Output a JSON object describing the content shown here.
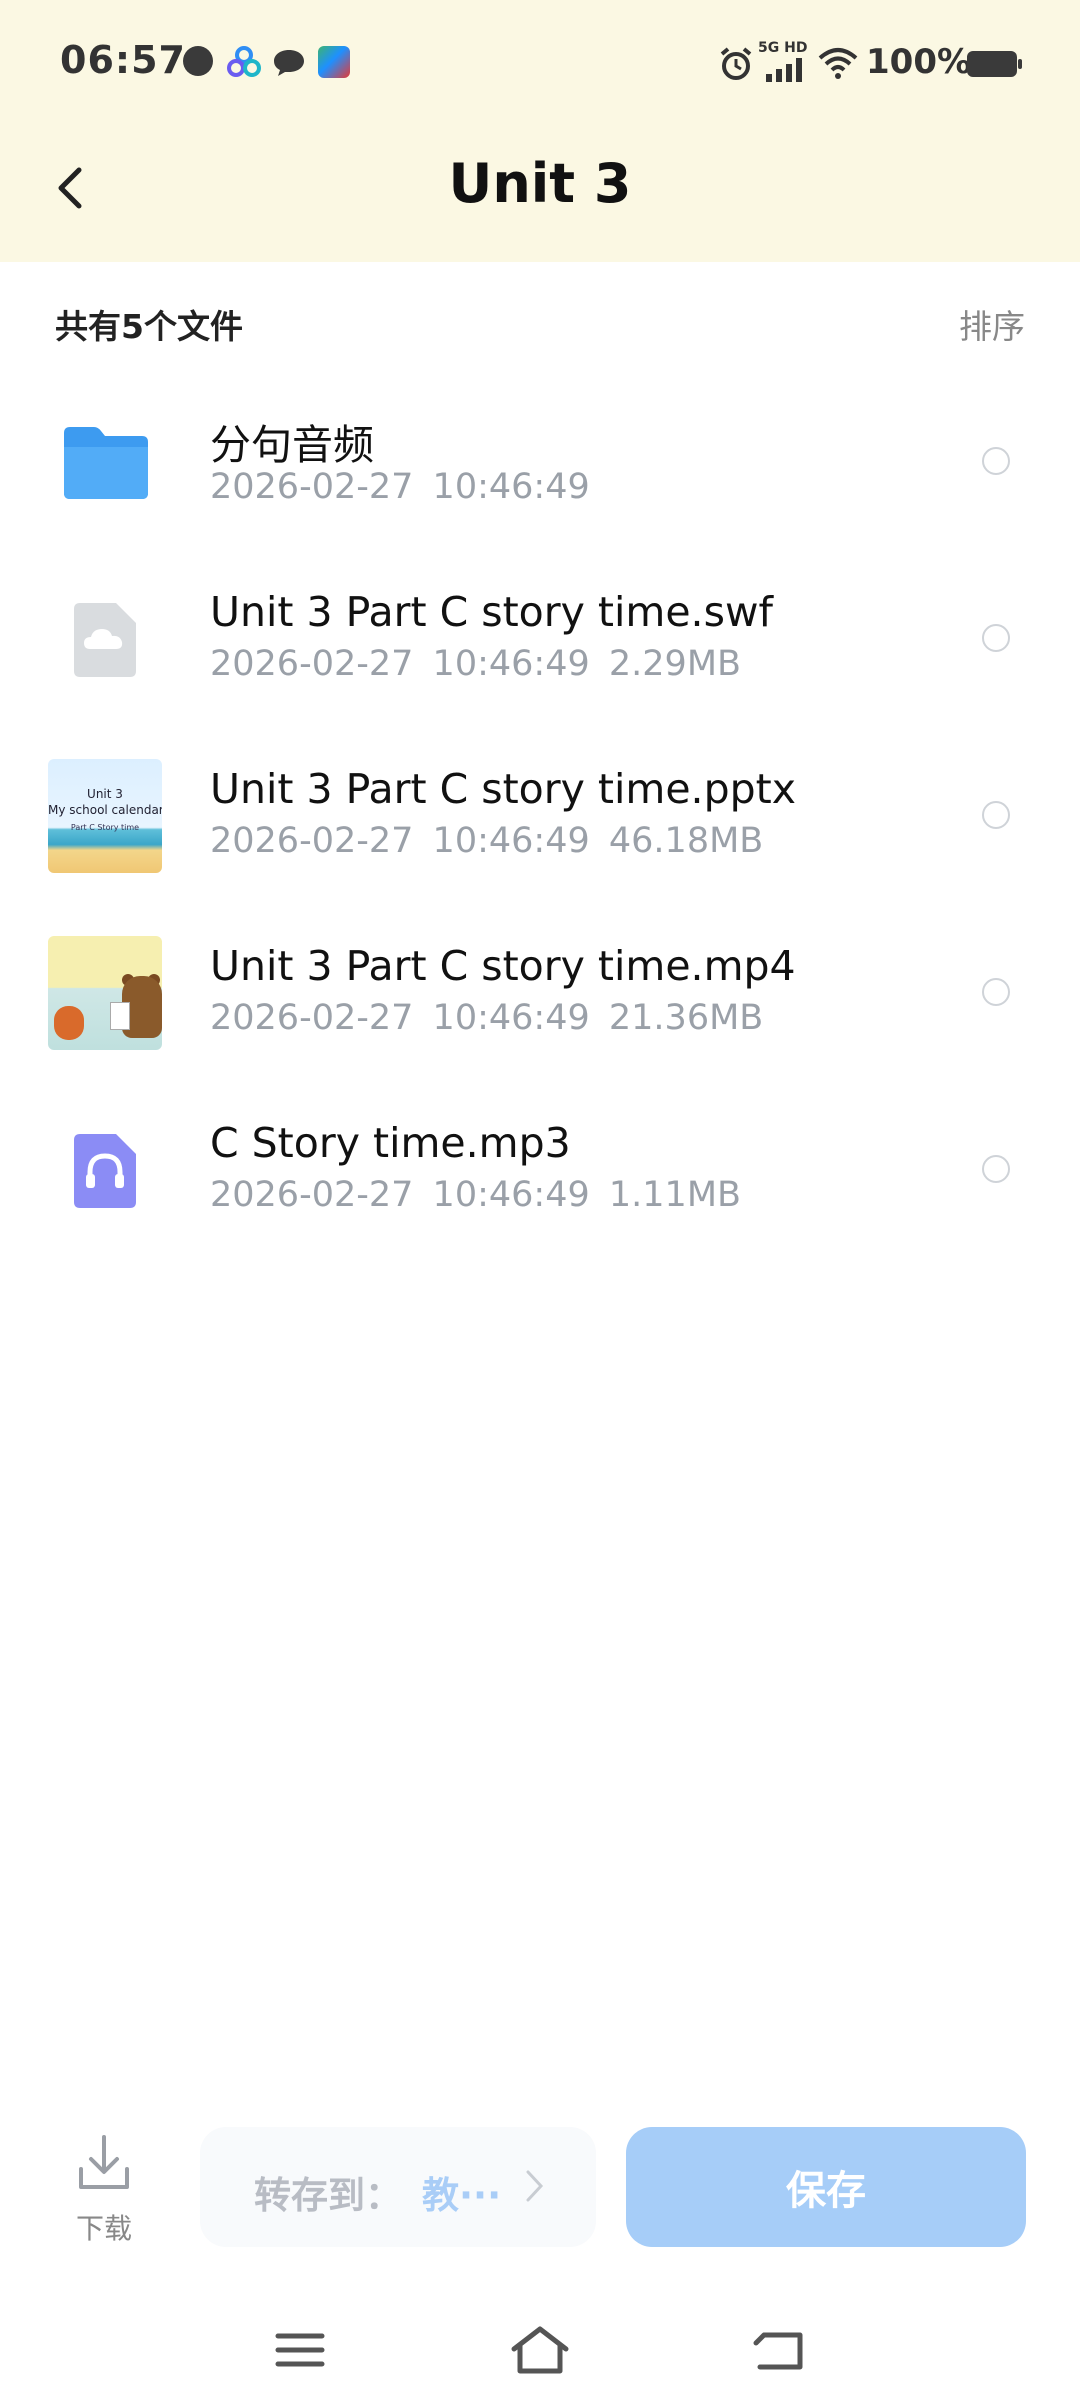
{
  "status_bar": {
    "time": "06:57",
    "network": "5G HD",
    "battery": "100%",
    "icons": [
      "dot-icon",
      "app-icon",
      "chat-icon",
      "game-icon",
      "alarm-icon",
      "signal-icon",
      "wifi-icon",
      "battery-icon"
    ]
  },
  "header": {
    "title": "Unit 3",
    "back_icon": "chevron-left-icon"
  },
  "list_header": {
    "count_text": "共有5个文件",
    "sort_label": "排序"
  },
  "files": [
    {
      "name": "分句音频",
      "date": "2026-02-27",
      "time": "10:46:49",
      "size": "",
      "icon": "folder-icon"
    },
    {
      "name": "Unit 3 Part C story time.swf",
      "date": "2026-02-27",
      "time": "10:46:49",
      "size": "2.29MB",
      "icon": "cloud-file-icon"
    },
    {
      "name": "Unit 3 Part C story time.pptx",
      "date": "2026-02-27",
      "time": "10:46:49",
      "size": "46.18MB",
      "icon": "pptx-thumbnail",
      "thumb_text": {
        "line1": "Unit 3",
        "line2": "My school calendar",
        "line3": "Part C Story time"
      }
    },
    {
      "name": "Unit 3 Part C story time.mp4",
      "date": "2026-02-27",
      "time": "10:46:49",
      "size": "21.36MB",
      "icon": "video-thumbnail"
    },
    {
      "name": "C Story time.mp3",
      "date": "2026-02-27",
      "time": "10:46:49",
      "size": "1.11MB",
      "icon": "headphones-icon"
    }
  ],
  "bottom_bar": {
    "download_label": "下载",
    "transfer_label": "转存到：",
    "transfer_target": "教···",
    "save_label": "保存"
  },
  "nav_bar": {
    "icons": [
      "menu-icon",
      "home-icon",
      "back-icon"
    ]
  },
  "colors": {
    "header_bg": "#fbf8e3",
    "save_button": "#a6cdf8",
    "folder": "#3d9bf0",
    "audio_icon": "#8b8cf5",
    "meta_text": "#9aa0a8"
  }
}
